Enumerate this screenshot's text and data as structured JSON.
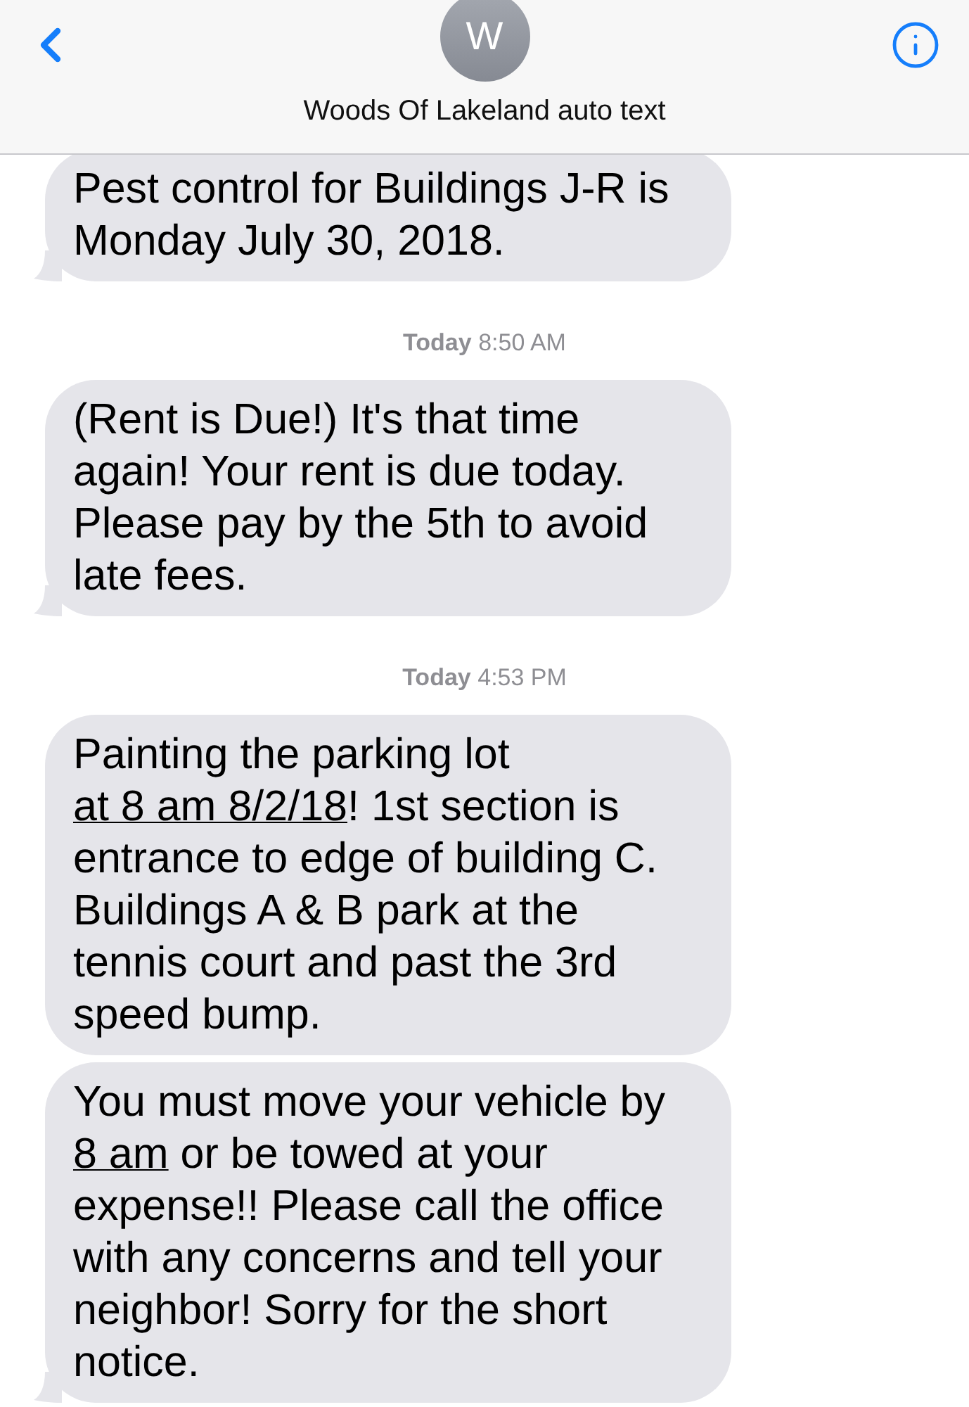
{
  "header": {
    "avatar_initial": "W",
    "contact_name": "Woods Of Lakeland auto text"
  },
  "messages": [
    {
      "kind": "bubble",
      "tail": true,
      "segments": [
        {
          "text": "Pest control for Buildings  J-R is Monday July 30, 2018.",
          "link": false
        }
      ]
    },
    {
      "kind": "timestamp",
      "day": "Today",
      "time": "8:50 AM"
    },
    {
      "kind": "bubble",
      "tail": true,
      "segments": [
        {
          "text": "(Rent is Due!) It's that time again! Your rent is due today. Please pay by the 5th to avoid late fees.",
          "link": false
        }
      ]
    },
    {
      "kind": "timestamp",
      "day": "Today",
      "time": "4:53 PM"
    },
    {
      "kind": "bubble",
      "tail": false,
      "segments": [
        {
          "text": "Painting the parking lot ",
          "link": false
        },
        {
          "text": "at 8 am 8/2/18",
          "link": true
        },
        {
          "text": "! 1st section is entrance to edge of building C. Buildings A & B park at the tennis court and past the 3rd speed bump.",
          "link": false
        }
      ]
    },
    {
      "kind": "bubble",
      "tail": true,
      "segments": [
        {
          "text": "You must move your vehicle by ",
          "link": false
        },
        {
          "text": "8 am",
          "link": true
        },
        {
          "text": " or be towed at your expense!! Please call the office with any concerns and tell your neighbor! Sorry for the short notice.",
          "link": false
        }
      ]
    }
  ]
}
